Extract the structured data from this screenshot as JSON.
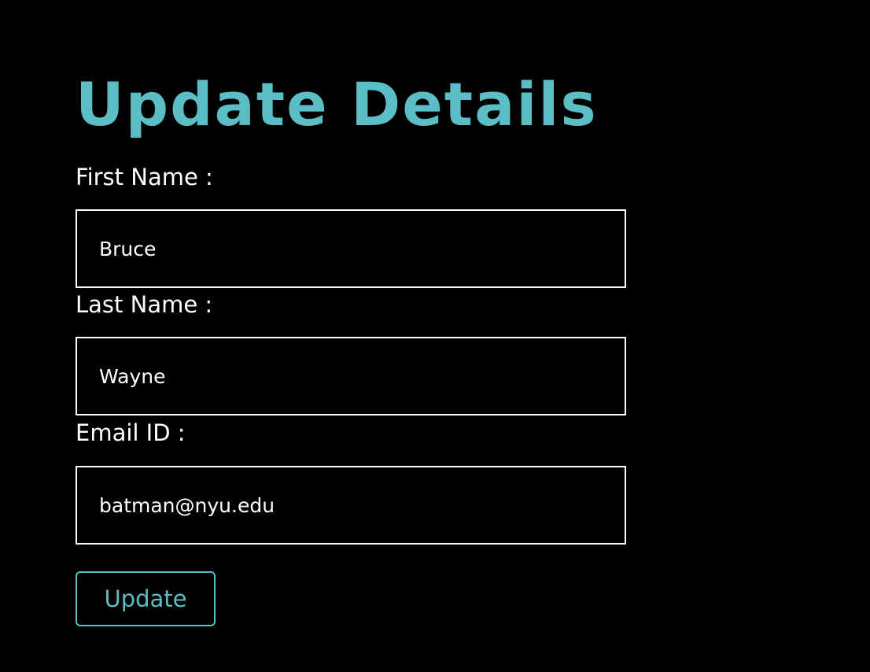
{
  "form": {
    "title": "Update Details",
    "fields": [
      {
        "label": "First Name :",
        "value": "Bruce"
      },
      {
        "label": "Last Name :",
        "value": "Wayne"
      },
      {
        "label": "Email ID :",
        "value": "batman@nyu.edu"
      }
    ],
    "submit_label": "Update"
  },
  "colors": {
    "background": "#000000",
    "accent": "#5bbdc6",
    "text": "#ffffff",
    "input_border": "#ffffff"
  }
}
